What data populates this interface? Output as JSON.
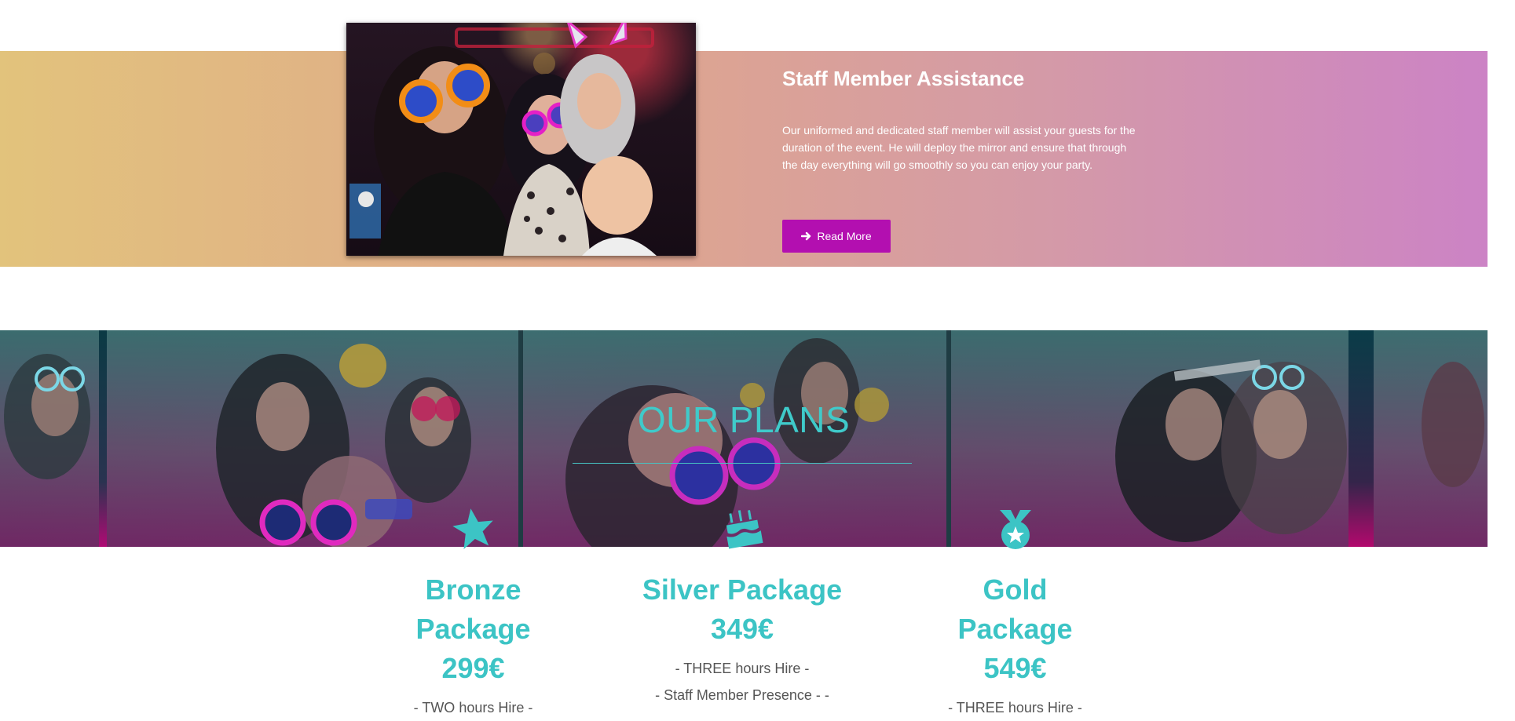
{
  "staff": {
    "title": "Staff Member Assistance",
    "description": "Our uniformed and dedicated staff member will assist your guests for the duration of the event. He will deploy the mirror and ensure that through the day everything will go smoothly so you can enjoy your party.",
    "read_more": {
      "icon": "arrow-right-icon",
      "label": "Read More"
    },
    "colors": {
      "gradient_start": "#e2c37c",
      "gradient_end": "#cc83c5",
      "button": "#b30fb0"
    }
  },
  "plans": {
    "title": "OUR PLANS",
    "accent_color": "#3cc4c5",
    "packages": [
      {
        "icon": "star-icon",
        "name": "Bronze Package 299€",
        "features": [
          "- TWO hours Hire -"
        ]
      },
      {
        "icon": "birthday-cake-icon",
        "name": "Silver Package 349€",
        "features": [
          "- THREE hours Hire -",
          "- Staff Member Presence - -"
        ]
      },
      {
        "icon": "medal-icon",
        "name": "Gold Package 549€",
        "features": [
          "- THREE hours Hire -"
        ]
      }
    ]
  }
}
